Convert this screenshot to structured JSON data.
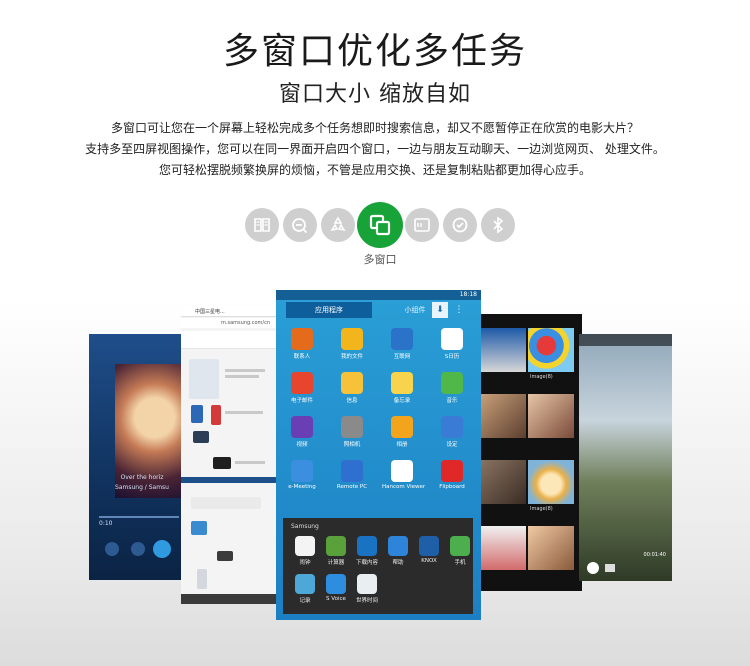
{
  "header": {
    "title": "多窗口优化多任务",
    "subtitle": "窗口大小 缩放自如",
    "desc_lines": [
      "多窗口可让您在一个屏幕上轻松完成多个任务想即时搜索信息，却又不愿暂停正在欣赏的电影大片？",
      "支持多至四屏视图操作，您可以在同一界面开启四个窗口，一边与朋友互动聊天、一边浏览网页、 处理文件。",
      "您可轻松摆脱频繁换屏的烦恼，不管是应用交换、还是复制粘贴都更加得心应手。"
    ]
  },
  "features": {
    "active_label": "多窗口",
    "active_color": "#17a338",
    "inactive_color": "#cfcfcf",
    "icons": [
      "book-icon",
      "minus-search-icon",
      "recycle-icon",
      "multi-window-icon",
      "nfc-card-icon",
      "check-circle-icon",
      "bluetooth-icon"
    ]
  },
  "music_phone": {
    "track": "Over the horiz",
    "artist": "Samsung / Samsu",
    "time": "0:10"
  },
  "browser_phone": {
    "tab_title": "中国三星电...",
    "url": "m.samsung.com/cn"
  },
  "main_phone": {
    "time": "18:18",
    "tabs": [
      "应用程序",
      "小组件"
    ],
    "apps": [
      {
        "label": "联系人",
        "color": "#e46a1c"
      },
      {
        "label": "我的文件",
        "color": "#f2b51b"
      },
      {
        "label": "互联网",
        "color": "#2a73c9"
      },
      {
        "label": "S日历",
        "color": "#ffffff"
      },
      {
        "label": "电子邮件",
        "color": "#e8452f"
      },
      {
        "label": "信息",
        "color": "#f6c23a"
      },
      {
        "label": "备忘录",
        "color": "#f7d44c"
      },
      {
        "label": "音乐",
        "color": "#4fb848"
      },
      {
        "label": "视频",
        "color": "#6a3fb5"
      },
      {
        "label": "照相机",
        "color": "#8a8a8a"
      },
      {
        "label": "相册",
        "color": "#f2a51c"
      },
      {
        "label": "设定",
        "color": "#3a7bd5"
      },
      {
        "label": "e-Meeting",
        "color": "#3b8ee0"
      },
      {
        "label": "Remote PC",
        "color": "#2f6fcf"
      },
      {
        "label": "Hancom Viewer",
        "color": "#ffffff"
      },
      {
        "label": "Flipboard",
        "color": "#e12828"
      }
    ],
    "popup_title": "Samsung",
    "popup_apps": [
      {
        "label": "闹钟",
        "color": "#f4f4f4"
      },
      {
        "label": "计算器",
        "color": "#5aa13b"
      },
      {
        "label": "下载内容",
        "color": "#1a72c2"
      },
      {
        "label": "帮助",
        "color": "#2d84d8"
      },
      {
        "label": "KNOX",
        "color": "#1e5fa8"
      },
      {
        "label": "手机",
        "color": "#4cae4c"
      },
      {
        "label": "记录",
        "color": "#4da8d8"
      },
      {
        "label": "S Voice",
        "color": "#2d8ee0"
      },
      {
        "label": "世界时间",
        "color": "#e9eef3"
      }
    ]
  },
  "gallery_phone": {
    "label1": "Image(8)",
    "label2": "Image(8)"
  },
  "video_phone": {
    "time": "00:01:40"
  }
}
